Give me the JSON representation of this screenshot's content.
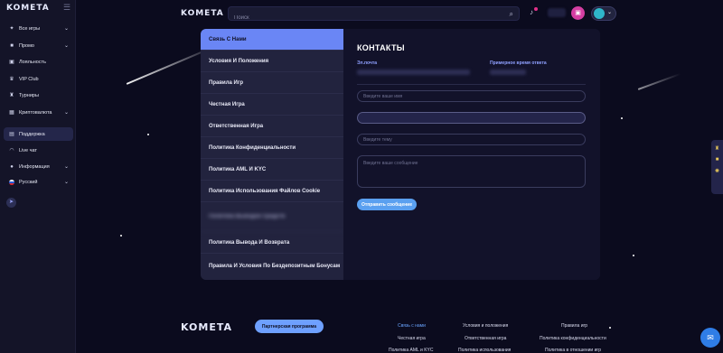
{
  "brand": {
    "name": "KOMETA"
  },
  "sidebar": {
    "collapse_icon": "collapse-icon",
    "items": [
      {
        "label": "Все игры",
        "icon": "game-icon",
        "has_chevron": true
      },
      {
        "label": "Промо",
        "icon": "gift-icon",
        "has_chevron": true
      },
      {
        "label": "Лояльность",
        "icon": "loyalty-icon",
        "has_chevron": false
      },
      {
        "label": "VIP Club",
        "icon": "crown-icon",
        "has_chevron": false
      },
      {
        "label": "Турниры",
        "icon": "trophy-icon",
        "has_chevron": false
      },
      {
        "label": "Криптовалюта",
        "icon": "crypto-icon",
        "has_chevron": true
      },
      {
        "label": "Поддержка",
        "icon": "support-icon",
        "has_chevron": false,
        "active": true
      },
      {
        "label": "Live чат",
        "icon": "headset-icon",
        "has_chevron": false
      },
      {
        "label": "Информация",
        "icon": "info-icon",
        "has_chevron": true
      },
      {
        "label": "Русский",
        "icon": "flag-ru-icon",
        "has_chevron": true
      }
    ]
  },
  "header": {
    "search_placeholder": "Поиск",
    "bell_icon": "bell-icon",
    "wallet_icon": "wallet-icon"
  },
  "support_menu": {
    "items": [
      "Связь С Нами",
      "Условия И Положения",
      "Правила Игр",
      "Честная Игра",
      "Ответственная Игра",
      "Политика Конфиденциальности",
      "Политика AML И KYC",
      "Политика Использования Файлов Cookie",
      "Политика Выводов Средств",
      "Политика Вывода И Возврата",
      "Правила И Условия По Бездепозитным Бонусам"
    ],
    "active_index": 0
  },
  "contacts": {
    "title": "КОНТАКТЫ",
    "email_label": "Эл.почта",
    "response_label": "Примерное время ответа",
    "name_placeholder": "Введите ваше имя",
    "topic_placeholder": "Введите тему",
    "message_placeholder": "Введите ваше сообщение",
    "submit_label": "Отправить сообщение"
  },
  "footer": {
    "partner_label": "Партнерская программа",
    "links": [
      {
        "label": "Связь с нами",
        "accent": true
      },
      {
        "label": "Условия и положения",
        "accent": false
      },
      {
        "label": "Правила игр",
        "accent": false
      },
      {
        "label": "Честная игра",
        "accent": false
      },
      {
        "label": "Ответственная игра",
        "accent": false
      },
      {
        "label": "Политика конфиденциальности",
        "accent": false
      },
      {
        "label": "Политика AML и KYC",
        "accent": false
      },
      {
        "label": "Политика использования",
        "accent": false
      },
      {
        "label": "Политика в отношении игр",
        "accent": false
      }
    ]
  },
  "colors": {
    "background": "#0b0b1e",
    "accent": "#6a86f5",
    "button": "#5aa0f0",
    "wallet": "#d43ea2"
  }
}
